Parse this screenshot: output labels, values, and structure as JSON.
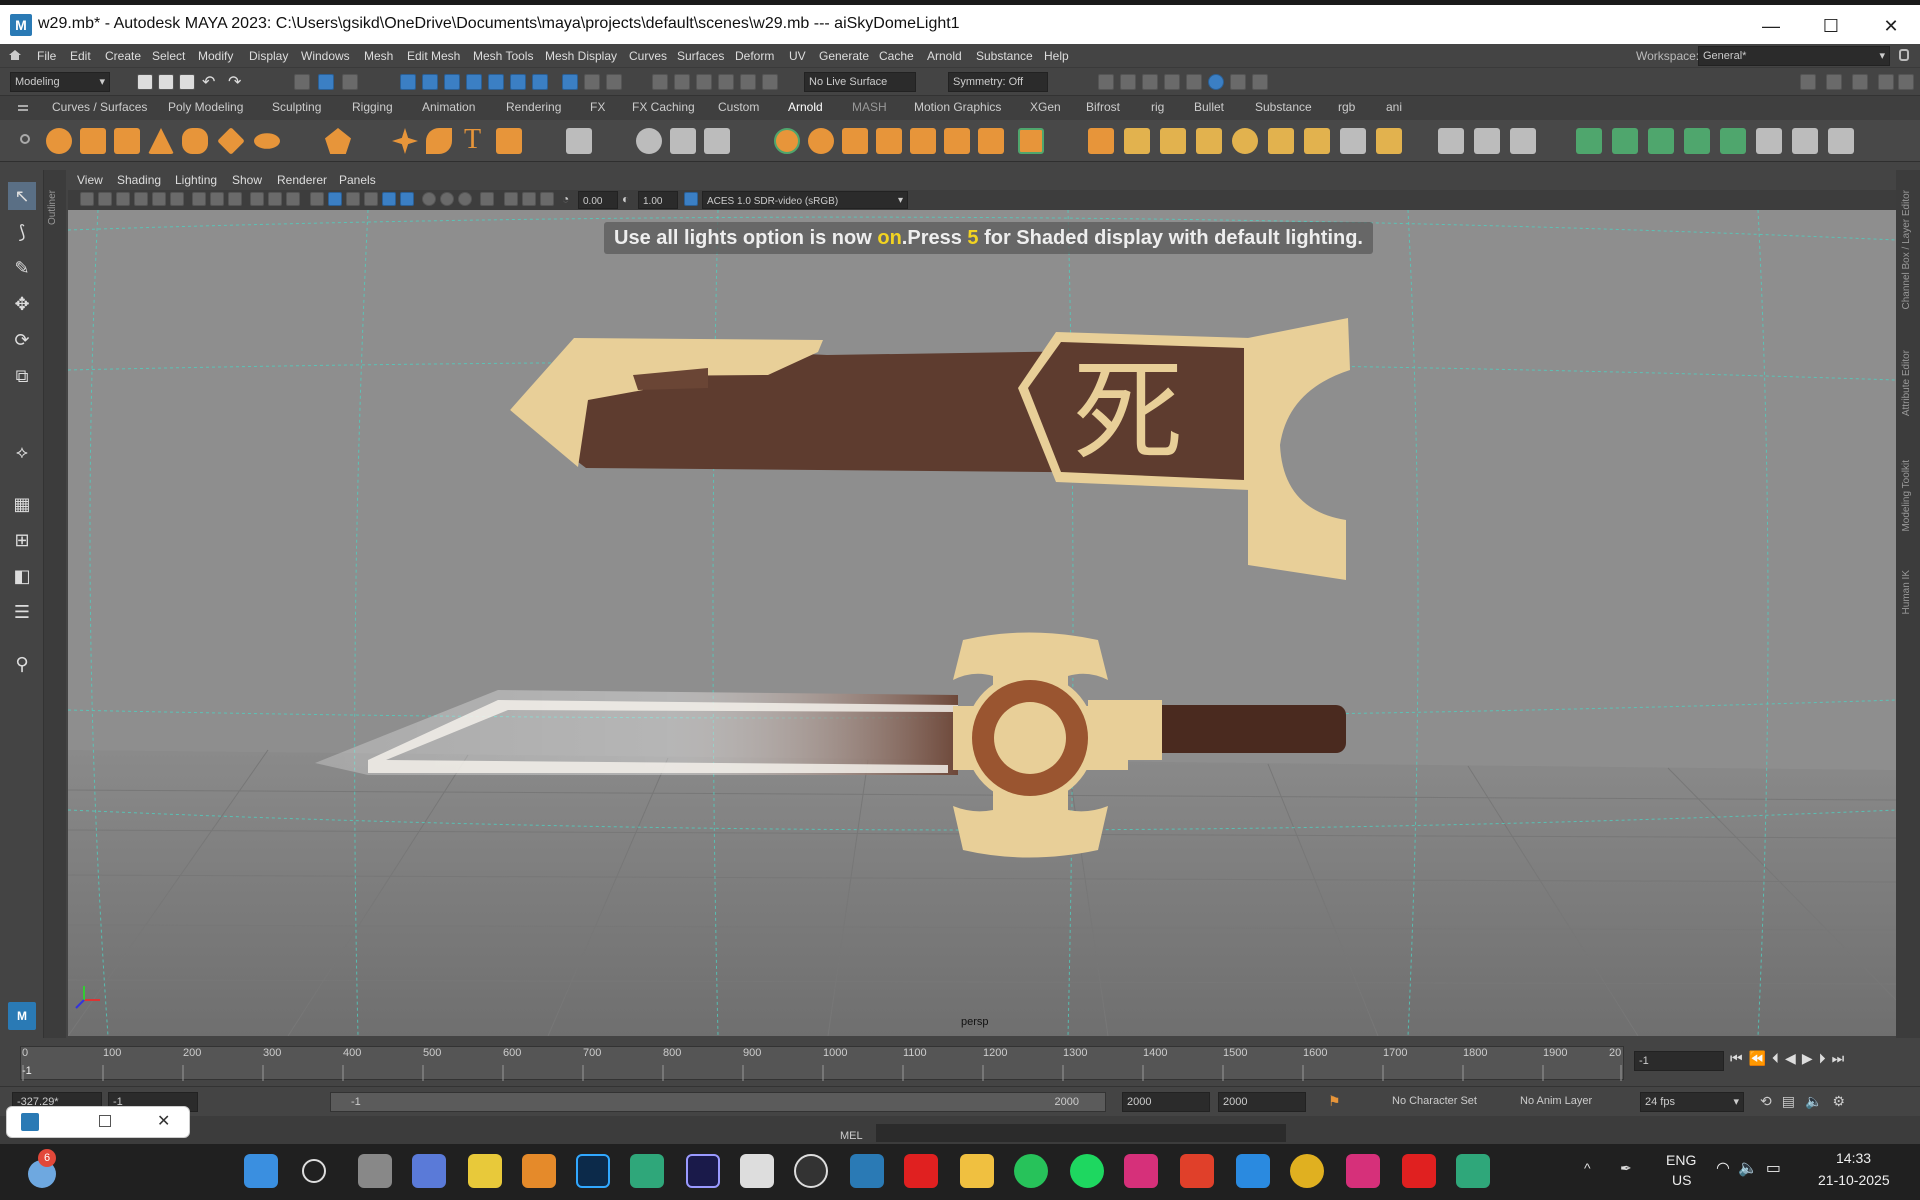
{
  "window": {
    "title": "w29.mb* - Autodesk MAYA 2023: C:\\Users\\gsikd\\OneDrive\\Documents\\maya\\projects\\default\\scenes\\w29.mb   ---   aiSkyDomeLight1",
    "app_icon": "M",
    "minimize": "—",
    "maximize": "☐",
    "close": "✕"
  },
  "menubar": {
    "items": [
      "File",
      "Edit",
      "Create",
      "Select",
      "Modify",
      "Display",
      "Windows",
      "Mesh",
      "Edit Mesh",
      "Mesh Tools",
      "Mesh Display",
      "Curves",
      "Surfaces",
      "Deform",
      "UV",
      "Generate",
      "Cache",
      "Arnold",
      "Substance",
      "Help"
    ],
    "workspace_label": "Workspace:",
    "workspace_value": "General*"
  },
  "statusline": {
    "mode": "Modeling",
    "live_surface": "No Live Surface",
    "symmetry": "Symmetry: Off"
  },
  "shelf_tabs": [
    "Curves / Surfaces",
    "Poly Modeling",
    "Sculpting",
    "Rigging",
    "Animation",
    "Rendering",
    "FX",
    "FX Caching",
    "Custom",
    "Arnold",
    "MASH",
    "Motion Graphics",
    "XGen",
    "Bifrost",
    "rig",
    "Bullet",
    "Substance",
    "rgb",
    "ani"
  ],
  "panel_menu": [
    "View",
    "Shading",
    "Lighting",
    "Show",
    "Renderer",
    "Panels"
  ],
  "panel_toolbar": {
    "value_a": "0.00",
    "value_b": "1.00",
    "colorspace": "ACES 1.0 SDR-video (sRGB)"
  },
  "viewport": {
    "hud_prefix": "Use all lights option is now ",
    "hud_on": "on",
    "hud_mid": ".Press ",
    "hud_key": "5",
    "hud_suffix": " for Shaded display with default lighting.",
    "camera": "persp",
    "glyph": "死"
  },
  "right_strip": [
    "Channel Box / Layer Editor",
    "Attribute Editor",
    "Modeling Toolkit",
    "Human IK"
  ],
  "outliner_label": "Outliner",
  "timeline": {
    "ticks": [
      "0",
      "100",
      "200",
      "300",
      "400",
      "500",
      "600",
      "700",
      "800",
      "900",
      "1000",
      "1100",
      "1200",
      "1300",
      "1400",
      "1500",
      "1600",
      "1700",
      "1800",
      "1900",
      "20"
    ],
    "current_frame": "-1",
    "playhead": "-1"
  },
  "range": {
    "start_value": "-327.29*",
    "start2": "-1",
    "slider_start": "-1",
    "slider_end": "2000",
    "end": "2000",
    "end2": "2000",
    "character_set": "No Character Set",
    "anim_layer": "No Anim Layer",
    "fps": "24 fps"
  },
  "mel": {
    "label": "MEL"
  },
  "taskbar": {
    "badge": "6",
    "lang_top": "ENG",
    "lang_bottom": "US",
    "time": "14:33",
    "date": "21-10-2025"
  },
  "colors": {
    "brown": "#5e3c2f",
    "cream": "#e8cf98",
    "handle": "#4a2a1f",
    "ring": "#9a5530",
    "grid": "#7f7f7f"
  }
}
